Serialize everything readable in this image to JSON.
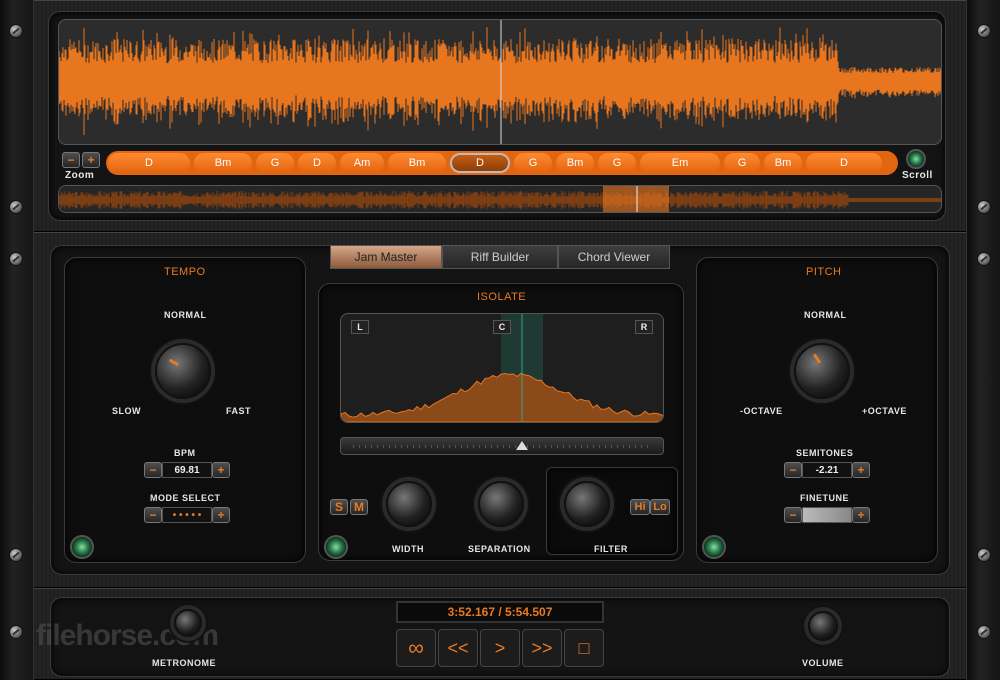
{
  "waveform": {
    "zoom_label": "Zoom",
    "scroll_label": "Scroll",
    "zoom_minus": "−",
    "zoom_plus": "+",
    "chords": [
      "D",
      "Bm",
      "G",
      "D",
      "Am",
      "Bm",
      "D",
      "G",
      "Bm",
      "G",
      "Em",
      "G",
      "Bm",
      "D"
    ],
    "active_chord_index": 6,
    "color": "#e8761f"
  },
  "tabs": [
    "Jam Master",
    "Riff Builder",
    "Chord Viewer"
  ],
  "tempo": {
    "title": "TEMPO",
    "normal": "NORMAL",
    "slow": "SLOW",
    "fast": "FAST",
    "bpm_label": "BPM",
    "bpm_value": "69.81",
    "mode_label": "MODE SELECT",
    "mode_value": "• • • • •"
  },
  "isolate": {
    "title": "ISOLATE",
    "left": "L",
    "center": "C",
    "right": "R",
    "s_label": "S",
    "m_label": "M",
    "width_label": "WIDTH",
    "separation_label": "SEPARATION",
    "filter_label": "FILTER",
    "hi_label": "Hi",
    "lo_label": "Lo"
  },
  "pitch": {
    "title": "PITCH",
    "normal": "NORMAL",
    "minus_octave": "-OCTAVE",
    "plus_octave": "+OCTAVE",
    "semitones_label": "SEMITONES",
    "semitones_value": "-2.21",
    "finetune_label": "FINETUNE"
  },
  "transport": {
    "time": "3:52.167 / 5:54.507",
    "loop_icon": "∞",
    "rewind_icon": "<<",
    "play_icon": ">",
    "forward_icon": ">>",
    "stop_icon": "□"
  },
  "metronome_label": "METRONOME",
  "volume_label": "VOLUME",
  "watermark": "filehorse.com"
}
